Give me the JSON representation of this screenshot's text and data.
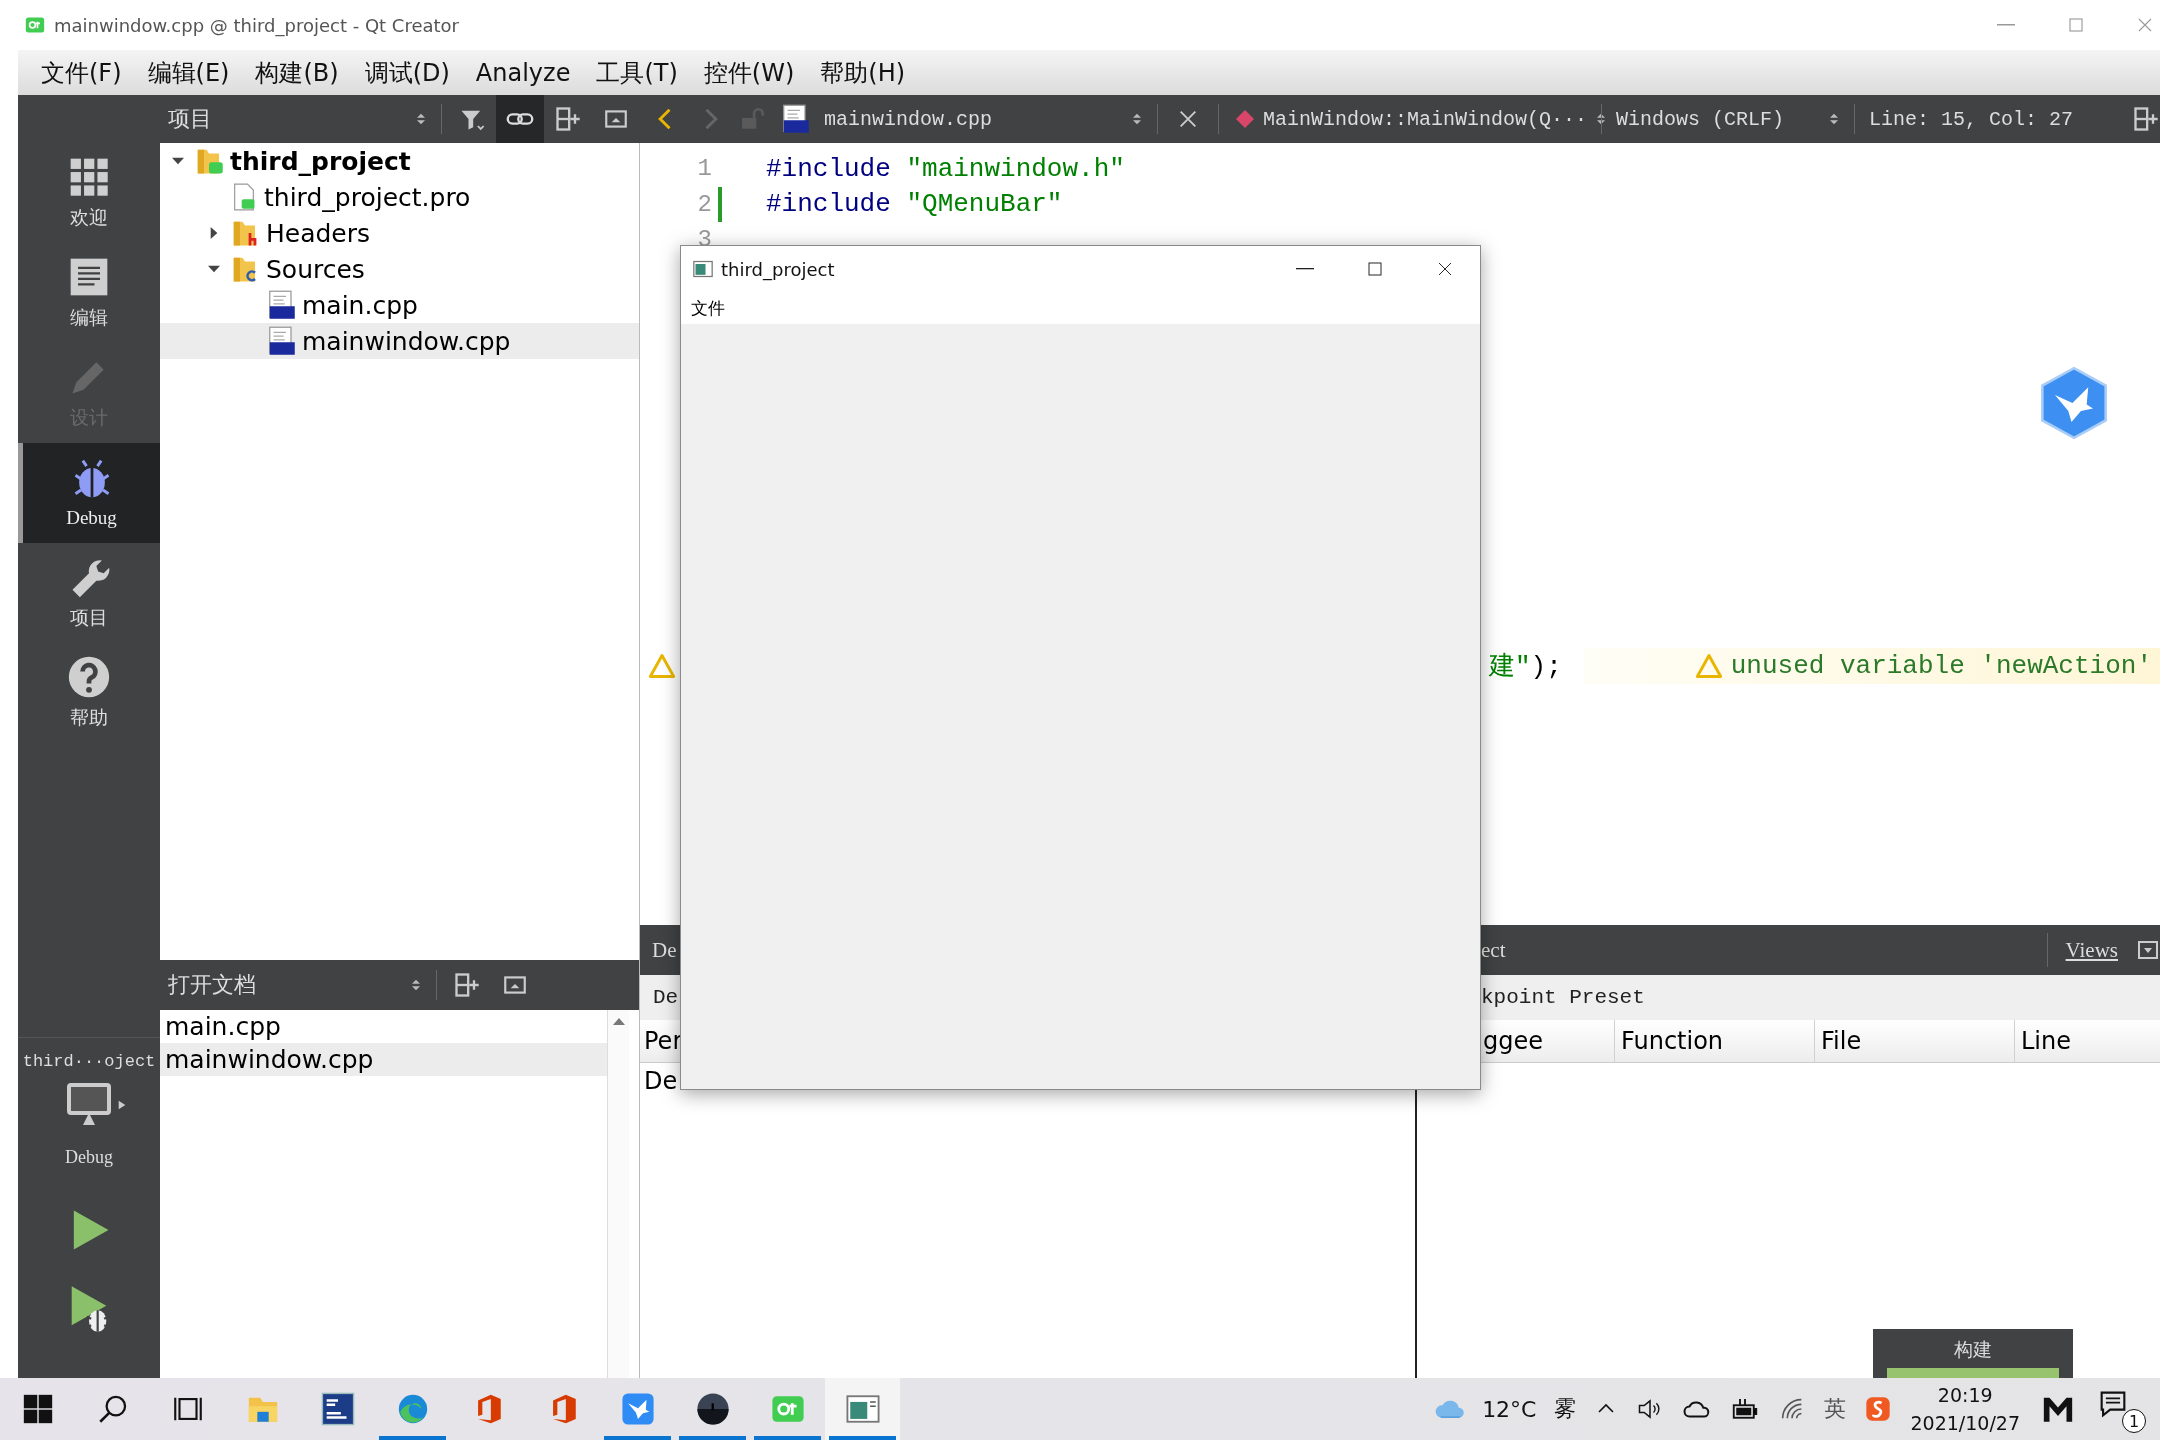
{
  "window": {
    "title": "mainwindow.cpp @ third_project - Qt Creator"
  },
  "menu": [
    "文件(F)",
    "编辑(E)",
    "构建(B)",
    "调试(D)",
    "Analyze",
    "工具(T)",
    "控件(W)",
    "帮助(H)"
  ],
  "toolbar": {
    "project_view": "项目",
    "sync_enabled": true,
    "back_enabled": true,
    "forward_enabled": false,
    "file": "mainwindow.cpp",
    "symbol": "MainWindow::MainWindow(Q···",
    "line_endings": "Windows (CRLF)",
    "position": "Line: 15, Col: 27"
  },
  "modes": [
    {
      "label": "欢迎",
      "kind": "welcome",
      "selected": false,
      "disabled": false
    },
    {
      "label": "编辑",
      "kind": "edit",
      "selected": false,
      "disabled": false
    },
    {
      "label": "设计",
      "kind": "design",
      "selected": false,
      "disabled": true
    },
    {
      "label": "Debug",
      "kind": "debug",
      "selected": true,
      "disabled": false
    },
    {
      "label": "项目",
      "kind": "projects",
      "selected": false,
      "disabled": false
    },
    {
      "label": "帮助",
      "kind": "help",
      "selected": false,
      "disabled": false
    }
  ],
  "target": {
    "project": "third···oject",
    "build": "Debug"
  },
  "project_tree": [
    {
      "label": "third_project",
      "kind": "project",
      "expanded": true,
      "selected": false,
      "children": [
        {
          "label": "third_project.pro",
          "kind": "pro",
          "selected": false
        },
        {
          "label": "Headers",
          "kind": "headers",
          "expanded": false,
          "selected": false
        },
        {
          "label": "Sources",
          "kind": "sources",
          "expanded": true,
          "selected": false,
          "children": [
            {
              "label": "main.cpp",
              "kind": "cpp",
              "selected": false
            },
            {
              "label": "mainwindow.cpp",
              "kind": "cpp",
              "selected": true
            }
          ]
        }
      ]
    }
  ],
  "open_documents": {
    "title": "打开文档",
    "items": [
      {
        "label": "main.cpp",
        "selected": false
      },
      {
        "label": "mainwindow.cpp",
        "selected": true
      }
    ]
  },
  "editor": {
    "lines": [
      {
        "number": "1",
        "modified": false,
        "tokens": [
          {
            "text": "#include",
            "kind": "preprocessor"
          },
          {
            "text": " \"mainwindow.h\"",
            "kind": "string"
          }
        ]
      },
      {
        "number": "2",
        "modified": true,
        "tokens": [
          {
            "text": "#include",
            "kind": "preprocessor"
          },
          {
            "text": " \"QMenuBar\"",
            "kind": "string"
          }
        ]
      },
      {
        "number": "3",
        "modified": false
      }
    ],
    "warning_line": {
      "tokens": [
        {
          "text": "建\"",
          "kind": "string"
        },
        {
          "text": ");",
          "kind": "plain"
        }
      ],
      "message": "unused variable 'newAction'"
    }
  },
  "preview_window": {
    "title": "third_project",
    "menu": [
      "文件"
    ]
  },
  "debugger_panel": {
    "left": {
      "title": "De",
      "toolbar": "De",
      "column": "Per",
      "rows": [
        "De"
      ]
    },
    "right": {
      "title": "ect",
      "views": "Views",
      "toolbar": "kpoint Preset",
      "columns": [
        "ggee",
        "Function",
        "File",
        "Line"
      ]
    }
  },
  "build_progress": {
    "label": "构建",
    "level": 1
  },
  "taskbar": {
    "apps": [
      {
        "kind": "start",
        "running": false,
        "selected": false
      },
      {
        "kind": "search",
        "running": false,
        "selected": false
      },
      {
        "kind": "task_view",
        "running": false,
        "selected": false
      },
      {
        "kind": "files",
        "running": false,
        "selected": false
      },
      {
        "kind": "devcpp",
        "running": false,
        "selected": false
      },
      {
        "kind": "edge",
        "running": true,
        "selected": false
      },
      {
        "kind": "office",
        "running": false,
        "selected": false
      },
      {
        "kind": "office",
        "running": false,
        "selected": false
      },
      {
        "kind": "bird",
        "running": true,
        "selected": false
      },
      {
        "kind": "moon",
        "running": true,
        "selected": false
      },
      {
        "kind": "qt",
        "running": true,
        "selected": false
      },
      {
        "kind": "window",
        "running": true,
        "selected": true
      }
    ],
    "weather": {
      "temperature": "12°C",
      "condition": "雾"
    },
    "input_method": "英",
    "time": "20:19",
    "date": "2021/10/27",
    "notification_count": "1"
  }
}
